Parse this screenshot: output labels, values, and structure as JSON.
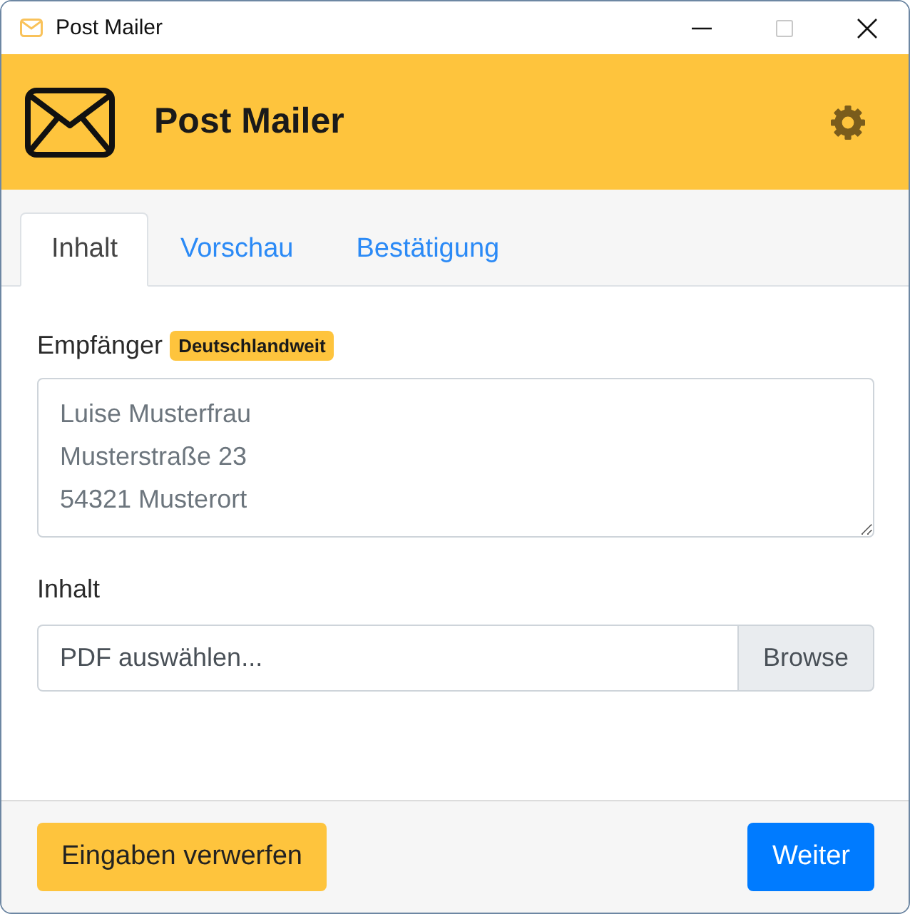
{
  "window": {
    "title": "Post Mailer",
    "controls": [
      {
        "kind": "minimize",
        "disabled": false
      },
      {
        "kind": "maximize",
        "disabled": true
      },
      {
        "kind": "close",
        "disabled": false
      }
    ]
  },
  "header": {
    "title": "Post Mailer"
  },
  "tabs": [
    {
      "label": "Inhalt",
      "selected": true
    },
    {
      "label": "Vorschau",
      "selected": false
    },
    {
      "label": "Bestätigung",
      "selected": false
    }
  ],
  "recipient": {
    "label": "Empfänger",
    "badge": "Deutschlandweit",
    "placeholder": "Luise Musterfrau\nMusterstraße 23\n54321 Musterort"
  },
  "content": {
    "label": "Inhalt",
    "placeholder": "PDF auswählen...",
    "button": "Browse"
  },
  "footer": {
    "buttons": [
      {
        "label": "Eingaben verwerfen",
        "kind": "warning"
      },
      {
        "label": "Weiter",
        "kind": "primary"
      }
    ]
  }
}
